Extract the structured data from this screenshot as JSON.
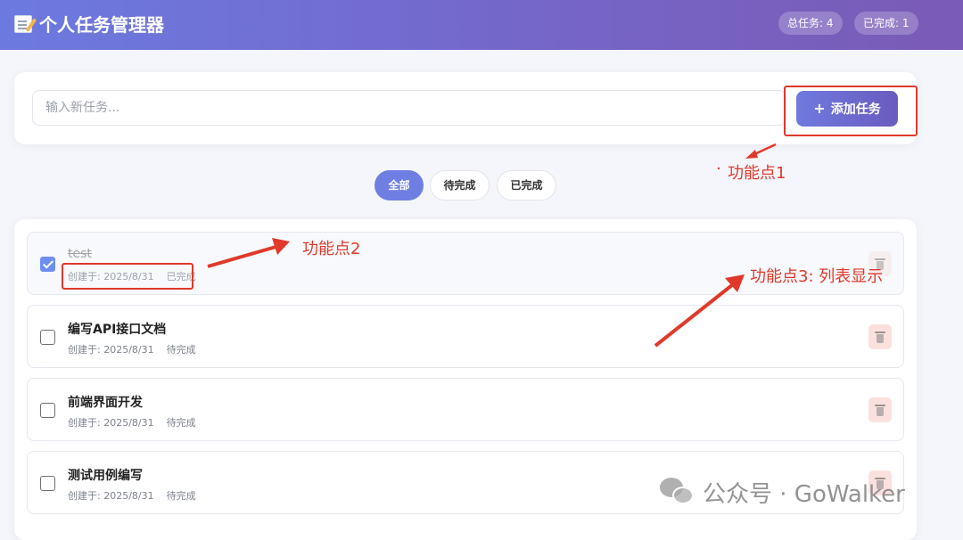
{
  "app": {
    "title": "个人任务管理器",
    "total_badge": "总任务: 4",
    "done_badge": "已完成: 1"
  },
  "input": {
    "placeholder": "输入新任务...",
    "value": "",
    "add_label": "添加任务",
    "add_icon": "+"
  },
  "filters": [
    {
      "label": "全部",
      "active": true
    },
    {
      "label": "待完成",
      "active": false
    },
    {
      "label": "已完成",
      "active": false
    }
  ],
  "tasks": [
    {
      "title": "test",
      "created": "创建于: 2025/8/31",
      "status": "已完成",
      "done": true
    },
    {
      "title": "编写API接口文档",
      "created": "创建于: 2025/8/31",
      "status": "待完成",
      "done": false
    },
    {
      "title": "前端界面开发",
      "created": "创建于: 2025/8/31",
      "status": "待完成",
      "done": false
    },
    {
      "title": "测试用例编写",
      "created": "创建于: 2025/8/31",
      "status": "待完成",
      "done": false
    }
  ],
  "annotations": {
    "point1": "功能点1",
    "point2": "功能点2",
    "point3": "功能点3: 列表显示",
    "color": "#e0392b"
  },
  "watermark": {
    "text": "公众号 · GoWalker"
  },
  "icons": {
    "title": "memo-icon",
    "delete": "trash-icon",
    "watermark": "wechat-icon"
  }
}
